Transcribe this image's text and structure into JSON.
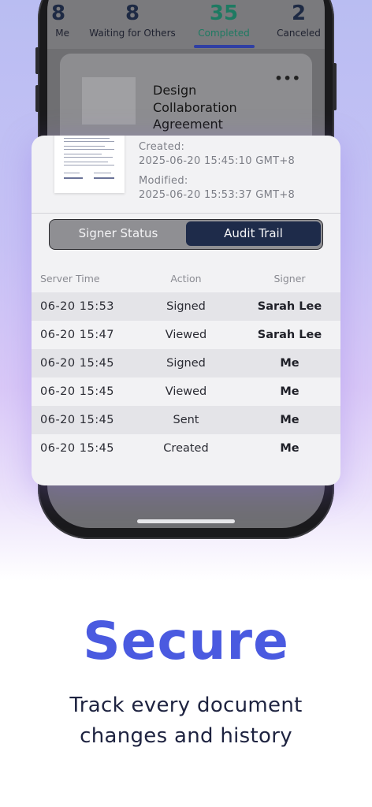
{
  "stats": [
    {
      "count": "8",
      "label": "Me"
    },
    {
      "count": "",
      "label": "Waiting for Others"
    },
    {
      "count": "35",
      "label": "Completed"
    },
    {
      "count": "2",
      "label": "Canceled"
    }
  ],
  "document": {
    "title_lines": [
      "Design",
      "Collaboration",
      "Agreement"
    ],
    "created_label": "Created:",
    "created_value": "2025-06-20 15:45:10 GMT+8",
    "modified_label": "Modified:",
    "modified_value": "2025-06-20 15:53:37 GMT+8"
  },
  "segmented": {
    "signer_status": "Signer Status",
    "audit_trail": "Audit Trail",
    "selected": "Audit Trail"
  },
  "table": {
    "headers": [
      "Server Time",
      "Action",
      "Signer"
    ],
    "rows": [
      {
        "time": "06-20 15:53",
        "action": "Signed",
        "signer": "Sarah Lee"
      },
      {
        "time": "06-20 15:47",
        "action": "Viewed",
        "signer": "Sarah Lee"
      },
      {
        "time": "06-20 15:45",
        "action": "Signed",
        "signer": "Me"
      },
      {
        "time": "06-20 15:45",
        "action": "Viewed",
        "signer": "Me"
      },
      {
        "time": "06-20 15:45",
        "action": "Sent",
        "signer": "Me"
      },
      {
        "time": "06-20 15:45",
        "action": "Created",
        "signer": "Me"
      }
    ]
  },
  "promo": {
    "headline": "Secure",
    "tagline_line1": "Track every document",
    "tagline_line2": "changes and history"
  },
  "colors": {
    "accent": "#4a5ae0",
    "completed": "#1e7a62",
    "segment_selected": "#1e2b4a"
  },
  "icons": {
    "more": "more-horizontal-icon"
  }
}
